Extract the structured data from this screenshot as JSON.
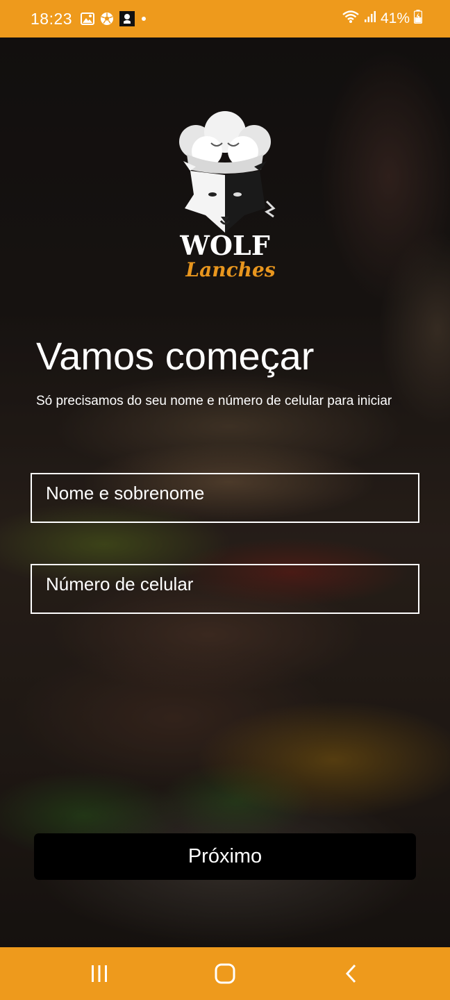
{
  "status_bar": {
    "time": "18:23",
    "battery": "41%",
    "icons_left": [
      "gallery-icon",
      "soccer-ball-icon",
      "app-notification-icon",
      "dot-icon"
    ],
    "icons_right": [
      "wifi-icon",
      "signal-icon",
      "battery-charging-icon"
    ],
    "color": "#ee9a1c"
  },
  "logo": {
    "brand": "WOLF",
    "script": "Lanches",
    "accent_color": "#e8961e"
  },
  "header": {
    "title": "Vamos começar",
    "subtitle": "Só precisamos do seu nome e número de celular para iniciar"
  },
  "form": {
    "name_placeholder": "Nome e sobrenome",
    "name_value": "",
    "phone_placeholder": "Número de celular",
    "phone_value": "",
    "next_label": "Próximo"
  },
  "nav_bar": {
    "buttons": [
      "recent-apps-icon",
      "home-icon",
      "back-icon"
    ],
    "color": "#ee9a1c"
  }
}
